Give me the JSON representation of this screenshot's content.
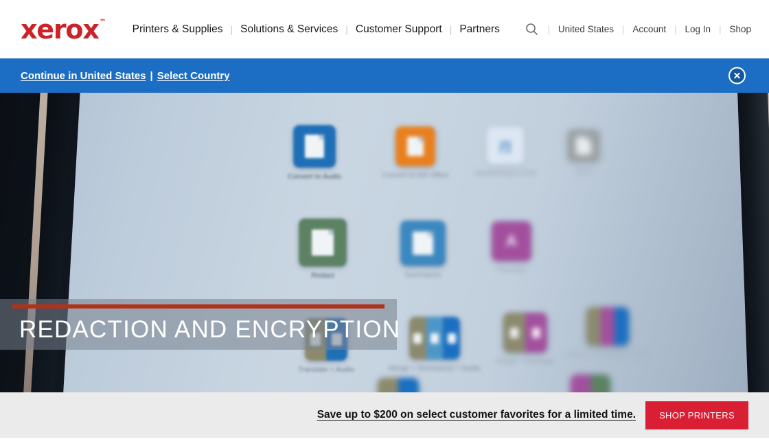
{
  "header": {
    "logo": {
      "word": "xerox",
      "tm": "™",
      "color": "#CC2229"
    },
    "main_nav": [
      {
        "label": "Printers & Supplies"
      },
      {
        "label": "Solutions & Services"
      },
      {
        "label": "Customer Support"
      },
      {
        "label": "Partners"
      }
    ],
    "separator": "|",
    "search_icon": "search-icon",
    "util_nav": [
      {
        "label": "United States"
      },
      {
        "label": "Account"
      },
      {
        "label": "Log In"
      },
      {
        "label": "Shop"
      }
    ]
  },
  "country_banner": {
    "continue_label": "Continue in United States",
    "pipe": "|",
    "select_label": "Select Country",
    "close_icon": "close-icon",
    "background": "#1B6EC4"
  },
  "hero": {
    "caption": "REDACTION AND ENCRYPTION",
    "rule_color": "#b3311a",
    "tiles": [
      {
        "label": "Convert to Audio",
        "color": "#1f6fb8"
      },
      {
        "label": "Convert to MS Office",
        "color": "#e8801f"
      },
      {
        "label": "Handwriting to Text",
        "color": "#dce7f3"
      },
      {
        "label": "OCR",
        "color": "#9aa0a2"
      },
      {
        "label": "Redact",
        "color": "#5c8263"
      },
      {
        "label": "Summarize",
        "color": "#3b87bf"
      },
      {
        "label": "Translate",
        "color": "#a2509e"
      },
      {
        "label": "Translate + Audio",
        "color": "#8b8a6e"
      },
      {
        "label": "Merge + Summarize + Audio",
        "color": "#8b8a6e"
      },
      {
        "label": "Merge + Translate",
        "color": "#8b8a6e"
      },
      {
        "label": "Merge + Translate + OCR",
        "color": "#8b8a6e"
      }
    ]
  },
  "promo": {
    "text": "Save up to $200 on select customer favorites for a limited time.",
    "button_label": "SHOP PRINTERS",
    "button_color": "#DA1F35",
    "background": "#ebebeb"
  }
}
